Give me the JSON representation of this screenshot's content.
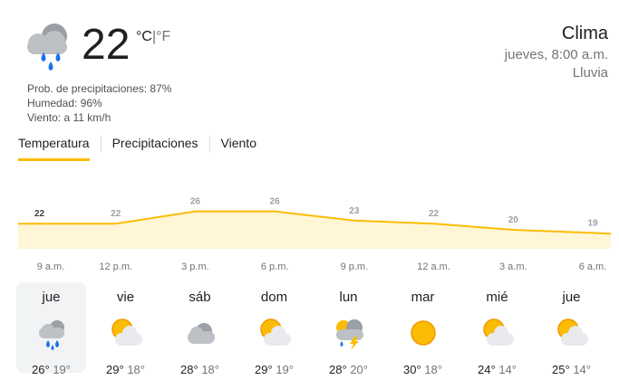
{
  "current": {
    "icon": "rain-cloud-icon",
    "temperature": "22",
    "unit_c": "°C",
    "unit_sep": "|",
    "unit_f": "°F",
    "precipitation": "Prob. de precipitaciones: 87%",
    "humidity": "Humedad: 96%",
    "wind": "Viento: a 11 km/h"
  },
  "header": {
    "title": "Clima",
    "datetime": "jueves, 8:00 a.m.",
    "condition": "Lluvia"
  },
  "tabs": [
    {
      "label": "Temperatura",
      "active": true
    },
    {
      "label": "Precipitaciones",
      "active": false
    },
    {
      "label": "Viento",
      "active": false
    }
  ],
  "chart_data": {
    "type": "area",
    "x": [
      "9 a.m.",
      "12 p.m.",
      "3 p.m.",
      "6 p.m.",
      "9 p.m.",
      "12 a.m.",
      "3 a.m.",
      "6 a.m."
    ],
    "values": [
      22,
      22,
      26,
      26,
      23,
      22,
      20,
      19
    ],
    "colors": {
      "line": "#fbbc04",
      "fill": "#fff6d6"
    }
  },
  "days": [
    {
      "name": "jue",
      "icon": "rain-cloud-icon",
      "hi": "26°",
      "lo": "19°",
      "selected": true
    },
    {
      "name": "vie",
      "icon": "partly-cloudy-icon",
      "hi": "29°",
      "lo": "18°",
      "selected": false
    },
    {
      "name": "sáb",
      "icon": "cloudy-icon",
      "hi": "28°",
      "lo": "18°",
      "selected": false
    },
    {
      "name": "dom",
      "icon": "partly-cloudy-icon",
      "hi": "29°",
      "lo": "19°",
      "selected": false
    },
    {
      "name": "lun",
      "icon": "thunderstorm-icon",
      "hi": "28°",
      "lo": "20°",
      "selected": false
    },
    {
      "name": "mar",
      "icon": "sunny-icon",
      "hi": "30°",
      "lo": "18°",
      "selected": false
    },
    {
      "name": "mié",
      "icon": "partly-cloudy-icon",
      "hi": "24°",
      "lo": "14°",
      "selected": false
    },
    {
      "name": "jue",
      "icon": "partly-cloudy-icon",
      "hi": "25°",
      "lo": "14°",
      "selected": false
    }
  ]
}
